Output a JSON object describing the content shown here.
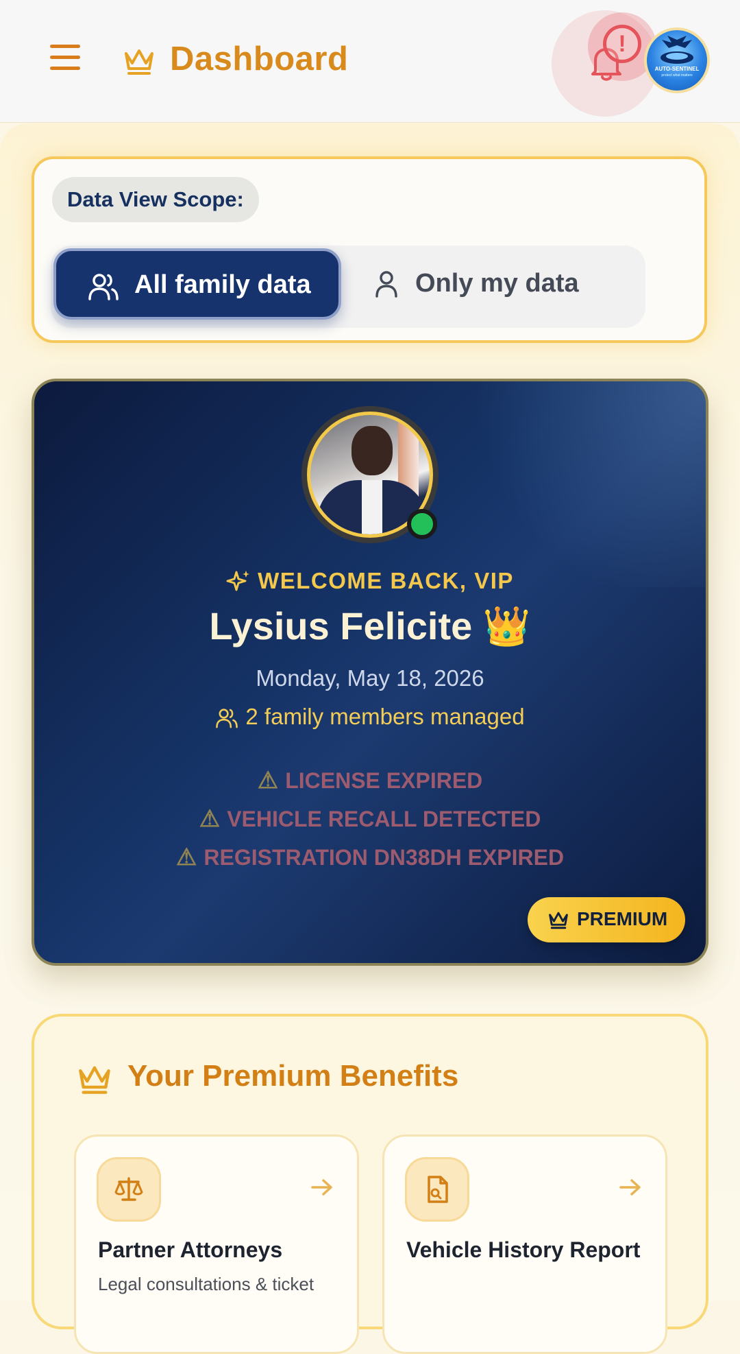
{
  "header": {
    "title": "Dashboard",
    "notification_alert_symbol": "!",
    "logo_text": "AUTO-SENTINEL",
    "logo_subtext": "protect what matters"
  },
  "scope": {
    "label": "Data View Scope:",
    "options": [
      {
        "label": "All family data",
        "selected": true
      },
      {
        "label": "Only my data",
        "selected": false
      }
    ]
  },
  "vip": {
    "welcome": "WELCOME BACK, VIP",
    "name": "Lysius Felicite 👑",
    "date": "Monday, May 18, 2026",
    "family": "2 family members managed",
    "alerts": [
      "LICENSE EXPIRED",
      "VEHICLE RECALL DETECTED",
      "REGISTRATION DN38DH EXPIRED"
    ],
    "badge": "PREMIUM",
    "online": true
  },
  "benefits": {
    "title": "Your Premium Benefits",
    "items": [
      {
        "name": "Partner Attorneys",
        "desc": "Legal consultations & ticket",
        "icon": "scale-icon"
      },
      {
        "name": "Vehicle History Report",
        "desc": "",
        "icon": "document-search-icon"
      }
    ]
  },
  "colors": {
    "accent": "#d98a1c",
    "navy": "#16336e",
    "gold": "#f3c84c",
    "alert_red": "#e5545a",
    "online": "#23c05a"
  }
}
